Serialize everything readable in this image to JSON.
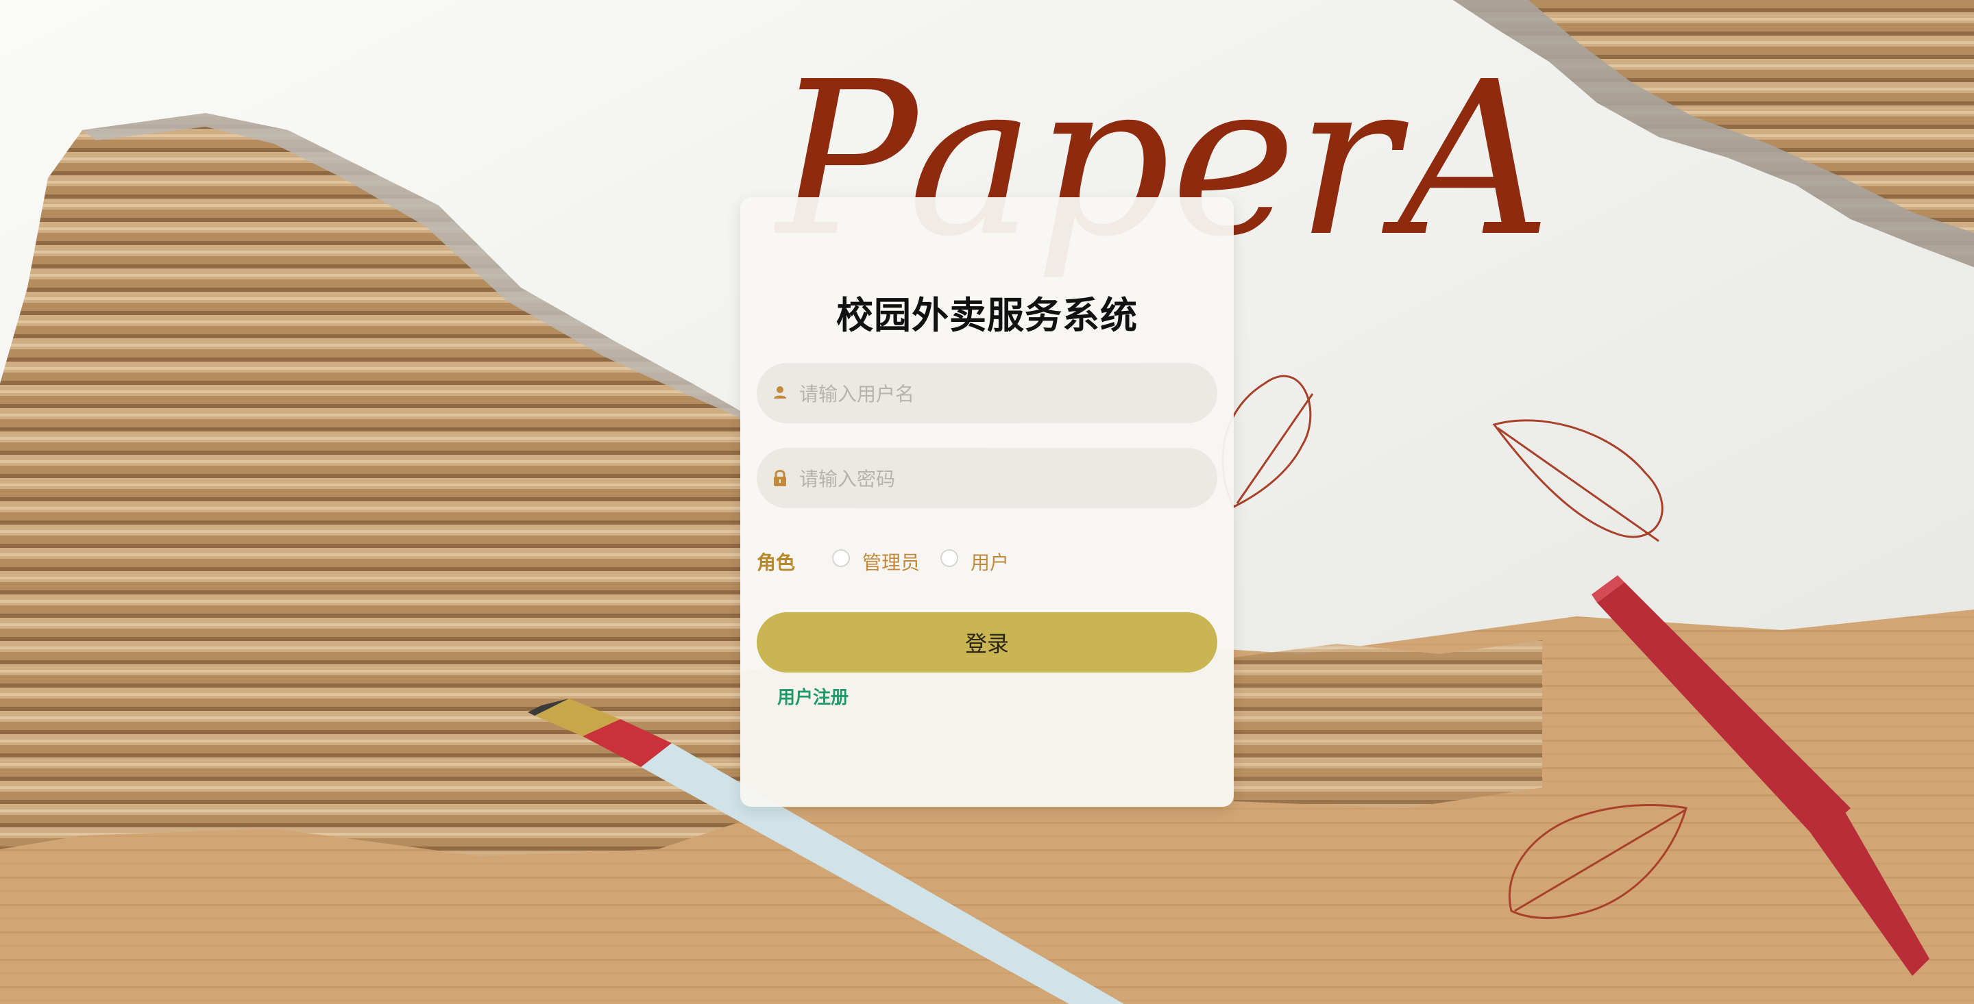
{
  "brand": {
    "logo_text": "PaperArt"
  },
  "login": {
    "title": "校园外卖服务系统",
    "username_placeholder": "请输入用户名",
    "password_placeholder": "请输入密码",
    "role_label": "角色",
    "role_options": [
      "管理员",
      "用户"
    ],
    "submit_label": "登录",
    "register_link": "用户注册"
  },
  "icons": {
    "username": "user-icon",
    "password": "lock-icon"
  },
  "colors": {
    "accent_button": "#c9b552",
    "role_label": "#b8892c",
    "register_link": "#1f9a69",
    "logo": "#8e2b0f"
  }
}
